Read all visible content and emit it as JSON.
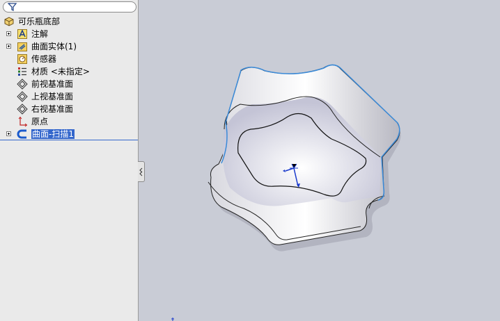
{
  "feature_tree": {
    "filter_icon": "filter-icon",
    "root": {
      "label": "可乐瓶底部",
      "icon": "part-icon"
    },
    "items": [
      {
        "label": "注解",
        "icon": "annotation-icon",
        "expandable": true
      },
      {
        "label": "曲面实体(1)",
        "icon": "surface-bodies-folder-icon",
        "expandable": true
      },
      {
        "label": "传感器",
        "icon": "sensor-icon",
        "expandable": false
      },
      {
        "label": "材质 <未指定>",
        "icon": "material-icon",
        "expandable": false
      },
      {
        "label": "前视基准面",
        "icon": "plane-icon",
        "expandable": false
      },
      {
        "label": "上视基准面",
        "icon": "plane-icon",
        "expandable": false
      },
      {
        "label": "右视基准面",
        "icon": "plane-icon",
        "expandable": false
      },
      {
        "label": "原点",
        "icon": "origin-icon",
        "expandable": false
      },
      {
        "label": "曲面-扫描1",
        "icon": "sweep-surface-icon",
        "expandable": true,
        "selected": true
      }
    ]
  },
  "colors": {
    "selection": "#3366cc",
    "viewport_background": "#c9ccd6",
    "edge_highlight": "#3a8ad8"
  }
}
